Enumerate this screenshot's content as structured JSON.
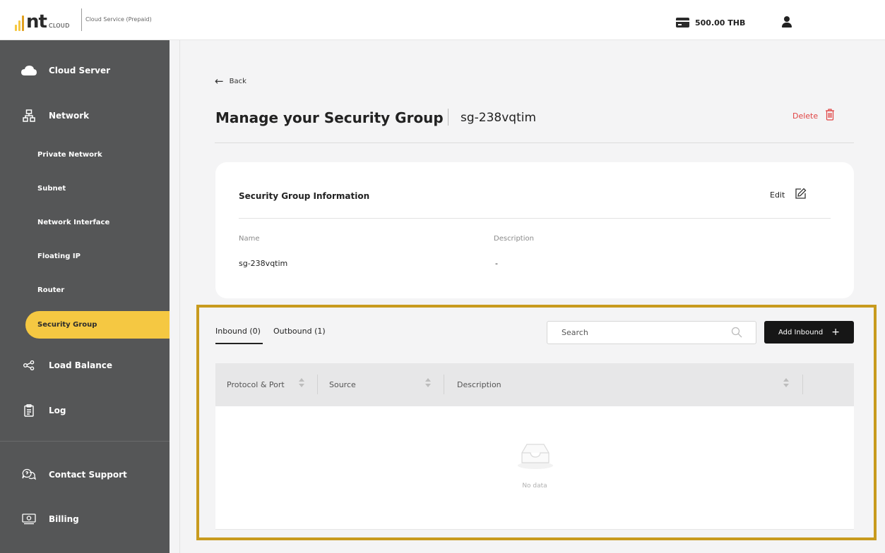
{
  "header": {
    "logo_text": "nt",
    "logo_subtext": "CLOUD",
    "service_label": "Cloud Service (Prepaid)",
    "balance": "500.00 THB",
    "logo_bar_colors": [
      "#f5c842",
      "#f5c842",
      "#e0a020"
    ]
  },
  "sidebar": {
    "cloud_server": "Cloud Server",
    "network": "Network",
    "private_network": "Private Network",
    "subnet": "Subnet",
    "network_interface": "Network Interface",
    "floating_ip": "Floating IP",
    "router": "Router",
    "security_group": "Security Group",
    "load_balance": "Load Balance",
    "log": "Log",
    "contact_support": "Contact Support",
    "billing": "Billing",
    "active_color": "#f5c842",
    "background": "#555657"
  },
  "page": {
    "back_label": "Back",
    "title": "Manage your Security Group",
    "group_id": "sg-238vqtim",
    "delete_label": "Delete",
    "delete_color": "#e04444"
  },
  "info_card": {
    "title": "Security Group Information",
    "edit_label": "Edit",
    "name_label": "Name",
    "name_value": "sg-238vqtim",
    "description_label": "Description",
    "description_value": "-"
  },
  "rules": {
    "tab_inbound": "Inbound (0)",
    "tab_outbound": "Outbound (1)",
    "search_placeholder": "Search",
    "add_button": "Add Inbound",
    "add_button_icon": "+",
    "columns": [
      "Protocol & Port",
      "Source",
      "Description"
    ],
    "empty_text": "No data",
    "highlight_color": "#c89b1e"
  }
}
